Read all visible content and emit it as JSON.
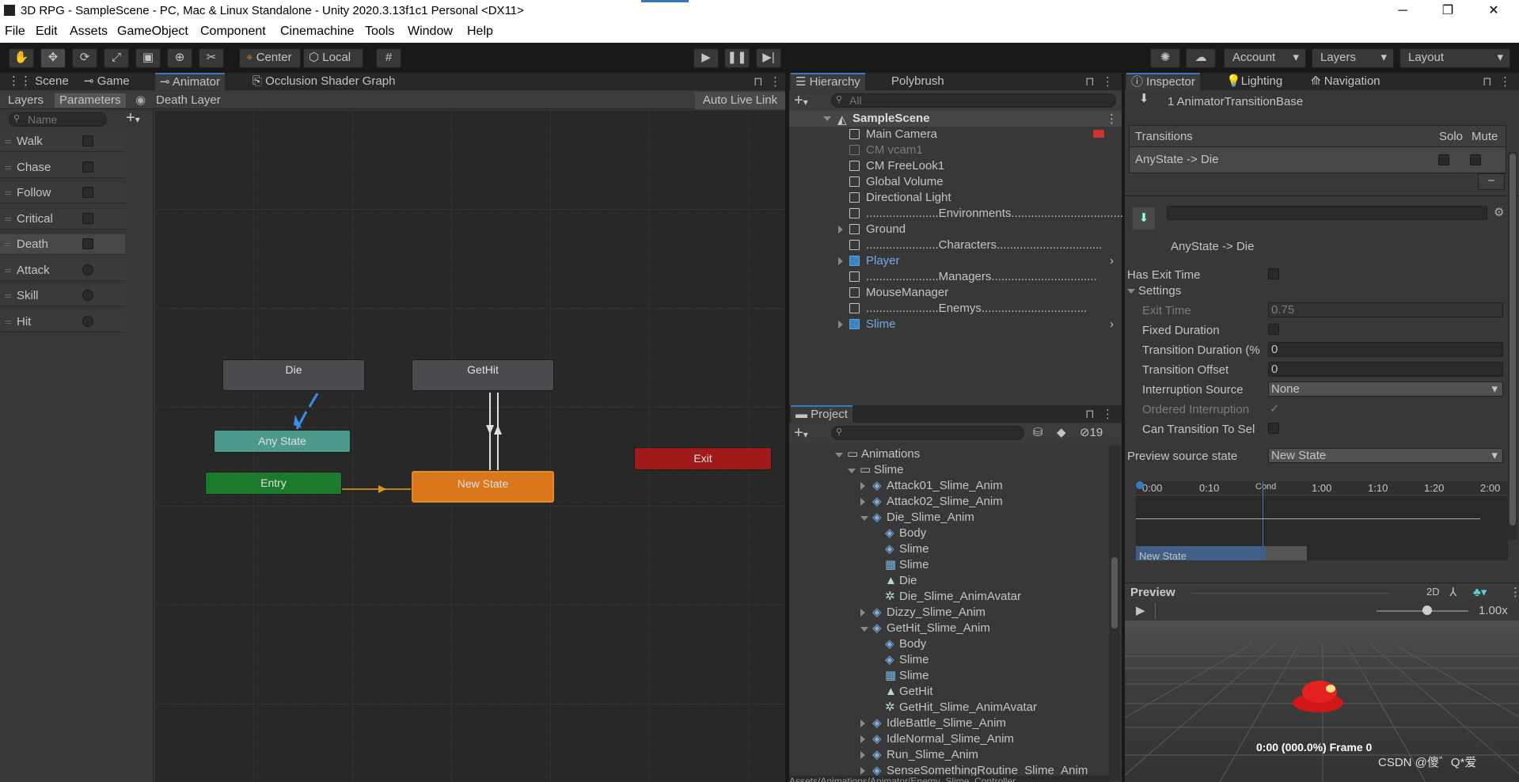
{
  "window": {
    "title": "3D RPG - SampleScene - PC, Mac & Linux Standalone - Unity 2020.3.13f1c1 Personal <DX11>",
    "minimize": "─",
    "maximize": "❐",
    "close": "✕"
  },
  "menu": [
    "File",
    "Edit",
    "Assets",
    "GameObject",
    "Component",
    "Cinemachine",
    "Tools",
    "Window",
    "Help"
  ],
  "toolbar": {
    "pivot": "Center",
    "space": "Local",
    "account": "Account",
    "layers": "Layers",
    "layout": "Layout"
  },
  "left_tabs": [
    "Scene",
    "Game",
    "Animator",
    "Occlusion Shader Graph"
  ],
  "animator": {
    "subtabs": [
      "Layers",
      "Parameters"
    ],
    "layer_name": "Death Layer",
    "auto_live_link": "Auto Live Link",
    "search_placeholder": "Name",
    "parameters": [
      {
        "name": "Walk",
        "type": "bool"
      },
      {
        "name": "Chase",
        "type": "bool"
      },
      {
        "name": "Follow",
        "type": "bool"
      },
      {
        "name": "Critical",
        "type": "bool"
      },
      {
        "name": "Death",
        "type": "bool",
        "selected": true
      },
      {
        "name": "Attack",
        "type": "trigger"
      },
      {
        "name": "Skill",
        "type": "trigger"
      },
      {
        "name": "Hit",
        "type": "trigger"
      }
    ],
    "nodes": {
      "die": "Die",
      "gethit": "GetHit",
      "anystate": "Any State",
      "entry": "Entry",
      "newstate": "New State",
      "exit": "Exit"
    }
  },
  "hierarchy": {
    "tabs": [
      "Hierarchy",
      "Polybrush"
    ],
    "search_placeholder": "All",
    "scene": "SampleScene",
    "items": [
      {
        "name": "Main Camera",
        "style": "normal"
      },
      {
        "name": "CM vcam1",
        "style": "disabled"
      },
      {
        "name": "CM FreeLook1",
        "style": "normal"
      },
      {
        "name": "Global Volume",
        "style": "normal"
      },
      {
        "name": "Directional Light",
        "style": "normal"
      },
      {
        "name": "......................Environments..................................",
        "style": "normal"
      },
      {
        "name": "Ground",
        "style": "normal",
        "expandable": true
      },
      {
        "name": "......................Characters................................",
        "style": "normal"
      },
      {
        "name": "Player",
        "style": "prefab",
        "expandable": true
      },
      {
        "name": "......................Managers................................",
        "style": "normal"
      },
      {
        "name": "MouseManager",
        "style": "normal"
      },
      {
        "name": "......................Enemys................................",
        "style": "normal"
      },
      {
        "name": "Slime",
        "style": "prefab",
        "expandable": true
      }
    ]
  },
  "project": {
    "tab": "Project",
    "hidden_count": "19",
    "tree": [
      {
        "name": "Animations",
        "indent": 0,
        "icon": "folder",
        "open": true
      },
      {
        "name": "Slime",
        "indent": 1,
        "icon": "folder",
        "open": true
      },
      {
        "name": "Attack01_Slime_Anim",
        "indent": 2,
        "icon": "model",
        "arrow": "right"
      },
      {
        "name": "Attack02_Slime_Anim",
        "indent": 2,
        "icon": "model",
        "arrow": "right"
      },
      {
        "name": "Die_Slime_Anim",
        "indent": 2,
        "icon": "model",
        "arrow": "down"
      },
      {
        "name": "Body",
        "indent": 3,
        "icon": "model"
      },
      {
        "name": "Slime",
        "indent": 3,
        "icon": "model"
      },
      {
        "name": "Slime",
        "indent": 3,
        "icon": "mesh"
      },
      {
        "name": "Die",
        "indent": 3,
        "icon": "anim"
      },
      {
        "name": "Die_Slime_AnimAvatar",
        "indent": 3,
        "icon": "avatar"
      },
      {
        "name": "Dizzy_Slime_Anim",
        "indent": 2,
        "icon": "model",
        "arrow": "right"
      },
      {
        "name": "GetHit_Slime_Anim",
        "indent": 2,
        "icon": "model",
        "arrow": "down"
      },
      {
        "name": "Body",
        "indent": 3,
        "icon": "model"
      },
      {
        "name": "Slime",
        "indent": 3,
        "icon": "model"
      },
      {
        "name": "Slime",
        "indent": 3,
        "icon": "mesh"
      },
      {
        "name": "GetHit",
        "indent": 3,
        "icon": "anim"
      },
      {
        "name": "GetHit_Slime_AnimAvatar",
        "indent": 3,
        "icon": "avatar"
      },
      {
        "name": "IdleBattle_Slime_Anim",
        "indent": 2,
        "icon": "model",
        "arrow": "right"
      },
      {
        "name": "IdleNormal_Slime_Anim",
        "indent": 2,
        "icon": "model",
        "arrow": "right"
      },
      {
        "name": "Run_Slime_Anim",
        "indent": 2,
        "icon": "model",
        "arrow": "right"
      },
      {
        "name": "SenseSomethingRoutine_Slime_Anim",
        "indent": 2,
        "icon": "model",
        "arrow": "right"
      }
    ],
    "path": "Assets/Animations/Animator/Enemy_Slime_Controller"
  },
  "inspector": {
    "tabs": [
      "Inspector",
      "Lighting",
      "Navigation"
    ],
    "header": "1 AnimatorTransitionBase",
    "transitions_label": "Transitions",
    "solo": "Solo",
    "mute": "Mute",
    "transition_item": "AnyState -> Die",
    "minus": "−",
    "transition_title": "AnyState -> Die",
    "has_exit_time": "Has Exit Time",
    "settings": "Settings",
    "exit_time_label": "Exit Time",
    "exit_time": "0.75",
    "fixed_duration": "Fixed Duration",
    "transition_duration_label": "Transition Duration (%",
    "transition_duration": "0",
    "transition_offset_label": "Transition Offset",
    "transition_offset": "0",
    "interruption_source_label": "Interruption Source",
    "interruption_source": "None",
    "ordered_interruption": "Ordered Interruption",
    "ordered_check": "✓",
    "can_transition_self": "Can Transition To Sel",
    "preview_source_label": "Preview source state",
    "preview_source": "New State",
    "timeline_ticks": [
      "0:00",
      "0:10",
      "",
      "1:00",
      "1:10",
      "1:20",
      "2:00"
    ],
    "timeline_cond": "Cond",
    "timeline_state": "New State",
    "preview_label": "Preview",
    "mode_2d": "2D",
    "speed": "1.00x",
    "frame_info": "0:00 (000.0%) Frame 0",
    "watermark": "CSDN @傻゛Q*爱"
  },
  "colors": {
    "accent": "#3a79bb",
    "node_gray": "#4a4b4e",
    "anystate": "#4d9a8c",
    "entry": "#1c7a2c",
    "newstate": "#d9771a",
    "exit": "#a11a1a",
    "prefab_text": "#7aa8e6"
  }
}
